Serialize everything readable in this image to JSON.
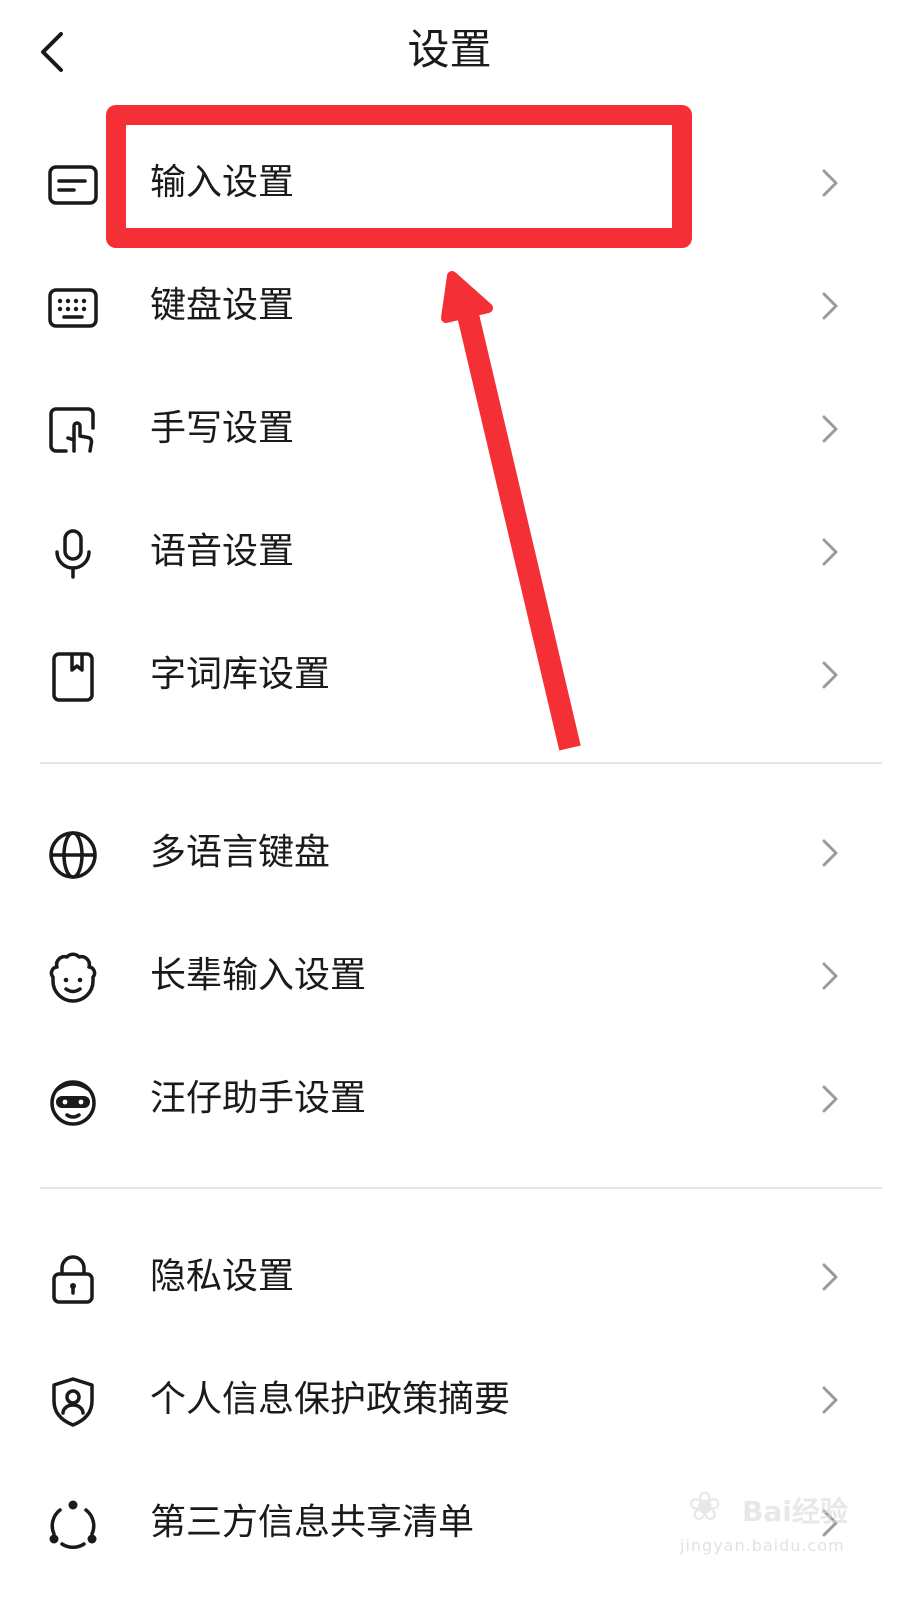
{
  "header": {
    "title": "设置"
  },
  "groups": [
    [
      {
        "icon": "input-icon",
        "label": "输入设置"
      },
      {
        "icon": "keyboard-icon",
        "label": "键盘设置"
      },
      {
        "icon": "handwriting-icon",
        "label": "手写设置"
      },
      {
        "icon": "microphone-icon",
        "label": "语音设置"
      },
      {
        "icon": "dictionary-icon",
        "label": "字词库设置"
      }
    ],
    [
      {
        "icon": "globe-icon",
        "label": "多语言键盘"
      },
      {
        "icon": "elder-face-icon",
        "label": "长辈输入设置"
      },
      {
        "icon": "assistant-mascot-icon",
        "label": "汪仔助手设置"
      }
    ],
    [
      {
        "icon": "lock-icon",
        "label": "隐私设置"
      },
      {
        "icon": "shield-user-icon",
        "label": "个人信息保护政策摘要"
      },
      {
        "icon": "share-nodes-icon",
        "label": "第三方信息共享清单"
      }
    ]
  ],
  "annotation": {
    "color": "#f42f36"
  },
  "watermark": {
    "brand": "Bai",
    "suffix": "经验",
    "url": "jingyan.baidu.com"
  }
}
